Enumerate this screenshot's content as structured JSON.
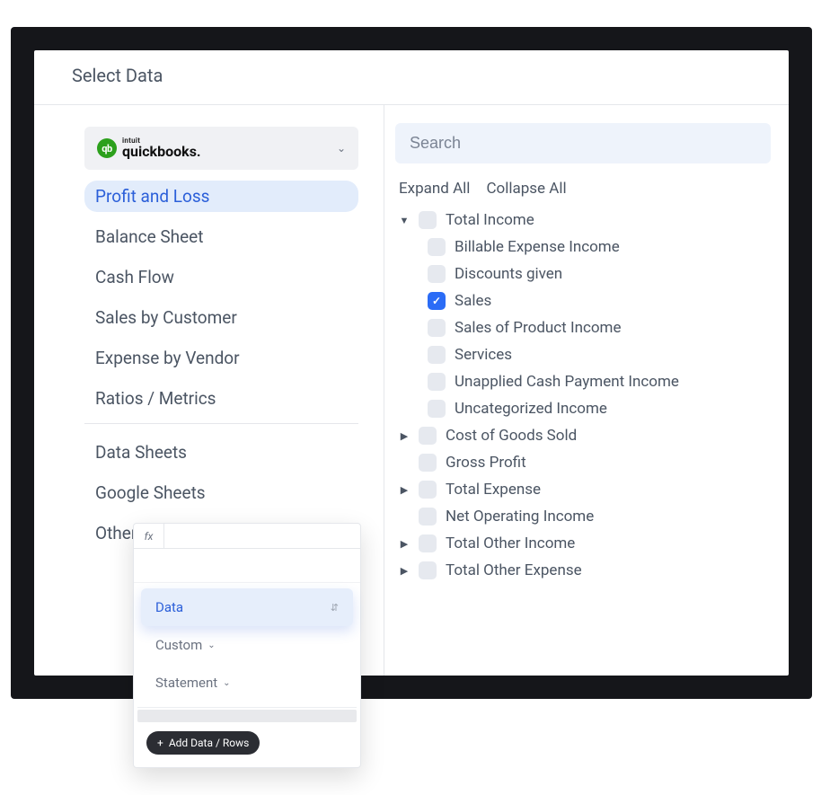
{
  "panel": {
    "title": "Select Data"
  },
  "source": {
    "intuit_label": "intuit",
    "name": "quickbooks.",
    "badge_text": "qb"
  },
  "nav": {
    "primary": [
      {
        "label": "Profit and Loss",
        "active": true
      },
      {
        "label": "Balance Sheet",
        "active": false
      },
      {
        "label": "Cash Flow",
        "active": false
      },
      {
        "label": "Sales by Customer",
        "active": false
      },
      {
        "label": "Expense by Vendor",
        "active": false
      },
      {
        "label": "Ratios / Metrics",
        "active": false
      }
    ],
    "secondary": [
      {
        "label": "Data Sheets"
      },
      {
        "label": "Google Sheets"
      },
      {
        "label": "Other"
      }
    ]
  },
  "search": {
    "placeholder": "Search"
  },
  "tree_actions": {
    "expand": "Expand All",
    "collapse": "Collapse All"
  },
  "tree": [
    {
      "label": "Total Income",
      "level": 0,
      "caret": "down",
      "checked": false
    },
    {
      "label": "Billable Expense Income",
      "level": 1,
      "caret": "none",
      "checked": false
    },
    {
      "label": "Discounts given",
      "level": 1,
      "caret": "none",
      "checked": false
    },
    {
      "label": "Sales",
      "level": 1,
      "caret": "none",
      "checked": true
    },
    {
      "label": "Sales of Product Income",
      "level": 1,
      "caret": "none",
      "checked": false
    },
    {
      "label": "Services",
      "level": 1,
      "caret": "none",
      "checked": false
    },
    {
      "label": "Unapplied Cash Payment Income",
      "level": 1,
      "caret": "none",
      "checked": false
    },
    {
      "label": "Uncategorized Income",
      "level": 1,
      "caret": "none",
      "checked": false
    },
    {
      "label": "Cost of Goods Sold",
      "level": 0,
      "caret": "right",
      "checked": false
    },
    {
      "label": "Gross Profit",
      "level": 0,
      "caret": "blank",
      "checked": false
    },
    {
      "label": "Total Expense",
      "level": 0,
      "caret": "right",
      "checked": false
    },
    {
      "label": "Net Operating Income",
      "level": 0,
      "caret": "blank",
      "checked": false
    },
    {
      "label": "Total Other Income",
      "level": 0,
      "caret": "right",
      "checked": false
    },
    {
      "label": "Total Other Expense",
      "level": 0,
      "caret": "right",
      "checked": false
    }
  ],
  "popover": {
    "fx": "fx",
    "items": [
      {
        "label": "Data",
        "active": true,
        "chevron": false,
        "trailing_icon": true
      },
      {
        "label": "Custom",
        "active": false,
        "chevron": true,
        "trailing_icon": false
      },
      {
        "label": "Statement",
        "active": false,
        "chevron": true,
        "trailing_icon": false
      }
    ],
    "add_label": "Add Data / Rows"
  }
}
